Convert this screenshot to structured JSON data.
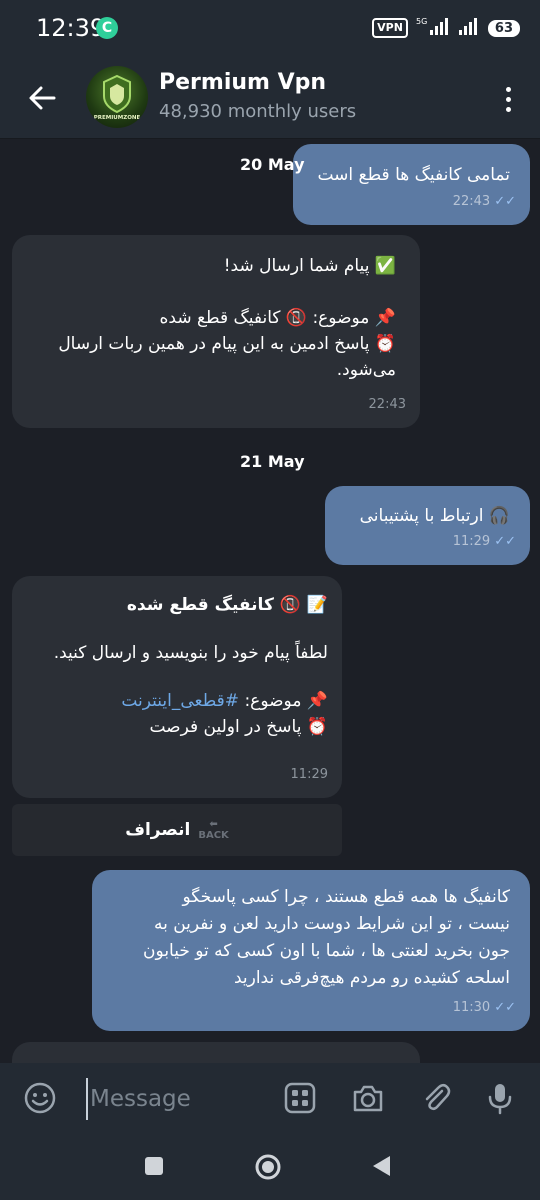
{
  "status_bar": {
    "time": "12:39",
    "vpn": "VPN",
    "network": "5G",
    "battery": "63"
  },
  "header": {
    "title": "Permium Vpn",
    "subtitle": "48,930 monthly users",
    "avatar_text": "PREMIUMZONE"
  },
  "messages": [
    {
      "dir": "out",
      "text": "تمامی کانفیگ ها قطع است",
      "time": "22:43"
    },
    {
      "dir": "in",
      "lines": [
        "✅ پیام شما ارسال شد!",
        "",
        "📌 موضوع: 📵 کانفیگ قطع شده",
        "⏰ پاسخ ادمین به این پیام در همین ربات ارسال",
        "می‌شود."
      ],
      "time": "22:43"
    },
    {
      "dir": "out",
      "text": "🎧 ارتباط با پشتیبانی",
      "time": "11:29"
    },
    {
      "dir": "in",
      "title": "📝 📵 کانفیگ قطع شده",
      "lines": [
        "لطفاً پیام خود را بنویسید و ارسال کنید.",
        "",
        "📌 موضوع: ",
        "⏰ پاسخ در اولین فرصت"
      ],
      "hashtag": "#قطعی_اینترنت",
      "time": "11:29"
    },
    {
      "dir": "out",
      "lines": [
        "کانفیگ ها همه قطع هستند ، چرا کسی پاسخگو",
        "نیست ، تو این شرایط دوست دارید لعن و نفرین به",
        "جون بخرید لعنتی ها ، شما با اون کسی که تو خیابون",
        "اسلحه کشیده رو مردم هیچ‌فرقی ندارید"
      ],
      "time": "11:30"
    }
  ],
  "dates": [
    "20 May",
    "21 May"
  ],
  "inline_button": {
    "label": "انصراف",
    "glyph": "BACK"
  },
  "composer": {
    "placeholder": "Message"
  },
  "colors": {
    "outgoing": "#5c7aa3",
    "incoming": "#2b2f36",
    "background": "#1c1f26",
    "bar": "#232a33",
    "link": "#6ea8e6"
  }
}
